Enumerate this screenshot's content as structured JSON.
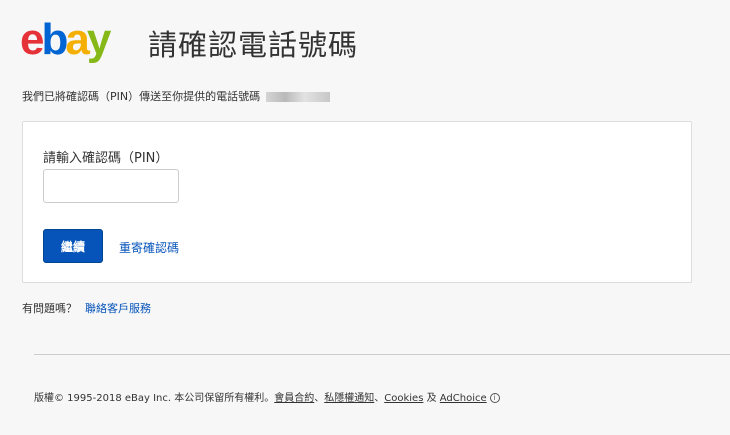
{
  "header": {
    "logo": {
      "e": "e",
      "b": "b",
      "a": "a",
      "y": "y"
    },
    "title": "請確認電話號碼"
  },
  "message": {
    "sent_text": "我們已將確認碼（PIN）傳送至你提供的電話號碼"
  },
  "form": {
    "pin_label": "請輸入確認碼（PIN）",
    "pin_value": "",
    "continue_label": "繼續",
    "resend_label": "重寄確認碼"
  },
  "help": {
    "question": "有問題嗎？",
    "link": "聯絡客戶服務"
  },
  "footer": {
    "copyright": "版權© 1995-2018 eBay Inc. 本公司保留所有權利。",
    "user_agreement": "會員合約",
    "sep1": "、",
    "privacy": "私隱權通知",
    "sep2": "、",
    "cookies": "Cookies",
    "and": " 及 ",
    "adchoice": "AdChoice",
    "adchoice_icon": "info-icon"
  },
  "colors": {
    "brand_red": "#e53238",
    "brand_blue": "#0064d2",
    "brand_yellow": "#f5af02",
    "brand_green": "#86b817",
    "primary_button": "#0654ba",
    "link": "#0654ba"
  }
}
